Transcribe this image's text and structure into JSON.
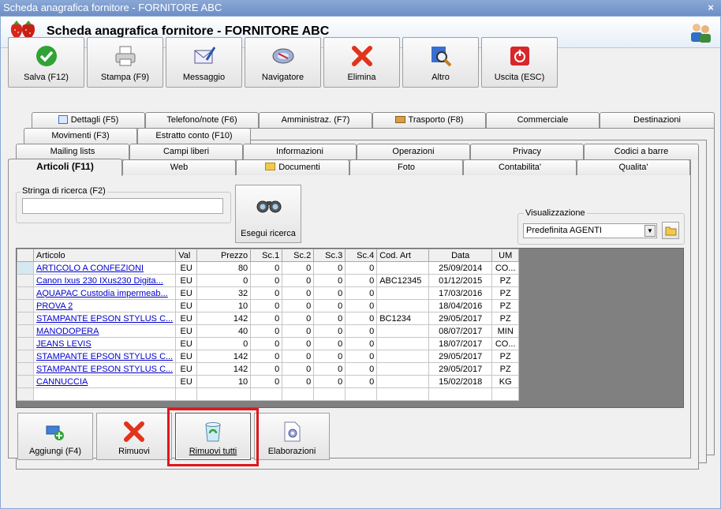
{
  "window": {
    "title": "Scheda anagrafica fornitore - FORNITORE ABC",
    "close_glyph": "×"
  },
  "header": {
    "title": "Scheda anagrafica fornitore - FORNITORE ABC",
    "logo_icon": "strawberry-logo",
    "user_icon": "users-icon"
  },
  "toolbar": {
    "items": [
      {
        "label": "Salva (F12)",
        "icon": "check-icon"
      },
      {
        "label": "Stampa (F9)",
        "icon": "printer-icon"
      },
      {
        "label": "Messaggio",
        "icon": "envelope-pen-icon"
      },
      {
        "label": "Navigatore",
        "icon": "compass-icon"
      },
      {
        "label": "Elimina",
        "icon": "red-x-icon"
      },
      {
        "label": "Altro",
        "icon": "magnifier-icon"
      },
      {
        "label": "Uscita (ESC)",
        "icon": "exit-icon"
      }
    ]
  },
  "tabs": {
    "row1": [
      "Dettagli (F5)",
      "Telefono/note (F6)",
      "Amministraz. (F7)",
      "Trasporto (F8)",
      "Commerciale",
      "Destinazioni"
    ],
    "row2": [
      "Movimenti (F3)",
      "Estratto conto (F10)"
    ],
    "row3": [
      "Mailing lists",
      "Campi liberi",
      "Informazioni",
      "Operazioni",
      "Privacy",
      "Codici a barre"
    ],
    "row4": [
      "Articoli (F11)",
      "Web",
      "Documenti",
      "Foto",
      "Contabilita'",
      "Qualita'"
    ]
  },
  "search": {
    "group_label": "Stringa di ricerca (F2)",
    "value": "",
    "button_label": "Esegui ricerca"
  },
  "view": {
    "group_label": "Visualizzazione",
    "selected": "Predefinita AGENTI"
  },
  "grid": {
    "columns": [
      "Articolo",
      "Val",
      "Prezzo",
      "Sc.1",
      "Sc.2",
      "Sc.3",
      "Sc.4",
      "Cod. Art",
      "Data",
      "UM"
    ],
    "rows": [
      [
        "ARTICOLO A CONFEZIONI",
        "EU",
        "80",
        "0",
        "0",
        "0",
        "0",
        "",
        "25/09/2014",
        "CO..."
      ],
      [
        "Canon Ixus 230 IXus230 Digita...",
        "EU",
        "0",
        "0",
        "0",
        "0",
        "0",
        "ABC12345",
        "01/12/2015",
        "PZ"
      ],
      [
        "AQUAPAC Custodia impermeab...",
        "EU",
        "32",
        "0",
        "0",
        "0",
        "0",
        "",
        "17/03/2016",
        "PZ"
      ],
      [
        "PROVA 2",
        "EU",
        "10",
        "0",
        "0",
        "0",
        "0",
        "",
        "18/04/2016",
        "PZ"
      ],
      [
        "STAMPANTE EPSON STYLUS C...",
        "EU",
        "142",
        "0",
        "0",
        "0",
        "0",
        "BC1234",
        "29/05/2017",
        "PZ"
      ],
      [
        "MANODOPERA",
        "EU",
        "40",
        "0",
        "0",
        "0",
        "0",
        "",
        "08/07/2017",
        "MIN"
      ],
      [
        "JEANS LEVIS",
        "EU",
        "0",
        "0",
        "0",
        "0",
        "0",
        "",
        "18/07/2017",
        "CO..."
      ],
      [
        "STAMPANTE EPSON STYLUS C...",
        "EU",
        "142",
        "0",
        "0",
        "0",
        "0",
        "",
        "29/05/2017",
        "PZ"
      ],
      [
        "STAMPANTE EPSON STYLUS C...",
        "EU",
        "142",
        "0",
        "0",
        "0",
        "0",
        "",
        "29/05/2017",
        "PZ"
      ],
      [
        "CANNUCCIA",
        "EU",
        "10",
        "0",
        "0",
        "0",
        "0",
        "",
        "15/02/2018",
        "KG"
      ]
    ]
  },
  "bottom_buttons": [
    {
      "label": "Aggiungi (F4)",
      "icon": "add-icon"
    },
    {
      "label": "Rimuovi",
      "icon": "red-x-icon"
    },
    {
      "label": "Rimuovi tutti",
      "icon": "recycle-bin-icon"
    },
    {
      "label": "Elaborazioni",
      "icon": "gear-document-icon"
    }
  ],
  "colors": {
    "link": "#0000cc",
    "highlight": "#e0161c",
    "titlebar": "#7b9bd0"
  }
}
